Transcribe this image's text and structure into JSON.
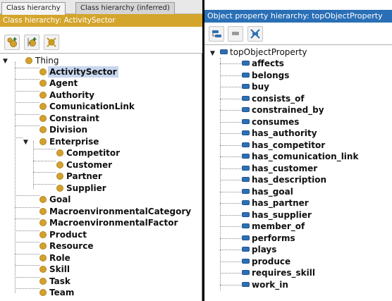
{
  "left_panel": {
    "tabs": [
      {
        "label": "Class hierarchy"
      },
      {
        "label": "Class hierarchy (inferred)"
      }
    ],
    "title": "Class hierarchy: ActivitySector",
    "tree": {
      "root": "Thing",
      "selected": "ActivitySector",
      "items": [
        "ActivitySector",
        "Agent",
        "Authority",
        "ComunicationLink",
        "Constraint",
        "Division",
        "Enterprise",
        "Competitor",
        "Customer",
        "Partner",
        "Supplier",
        "Goal",
        "MacroenvironmentalCategory",
        "MacroenvironmentalFactor",
        "Product",
        "Resource",
        "Role",
        "Skill",
        "Task",
        "Team"
      ]
    },
    "colors": {
      "title_bg": "#d4a52c",
      "class_icon": "#d3a12e",
      "selection": "#c7d7ee"
    }
  },
  "right_panel": {
    "title": "Object property hierarchy: topObjectProperty",
    "tree": {
      "root": "topObjectProperty",
      "items": [
        "affects",
        "belongs",
        "buy",
        "consists_of",
        "constrained_by",
        "consumes",
        "has_authority",
        "has_competitor",
        "has_comunication_link",
        "has_customer",
        "has_description",
        "has_goal",
        "has_partner",
        "has_supplier",
        "member_of",
        "performs",
        "plays",
        "produce",
        "requires_skill",
        "work_in"
      ]
    },
    "colors": {
      "title_bg": "#2a6fb6",
      "property_icon": "#2d6fb3"
    }
  }
}
